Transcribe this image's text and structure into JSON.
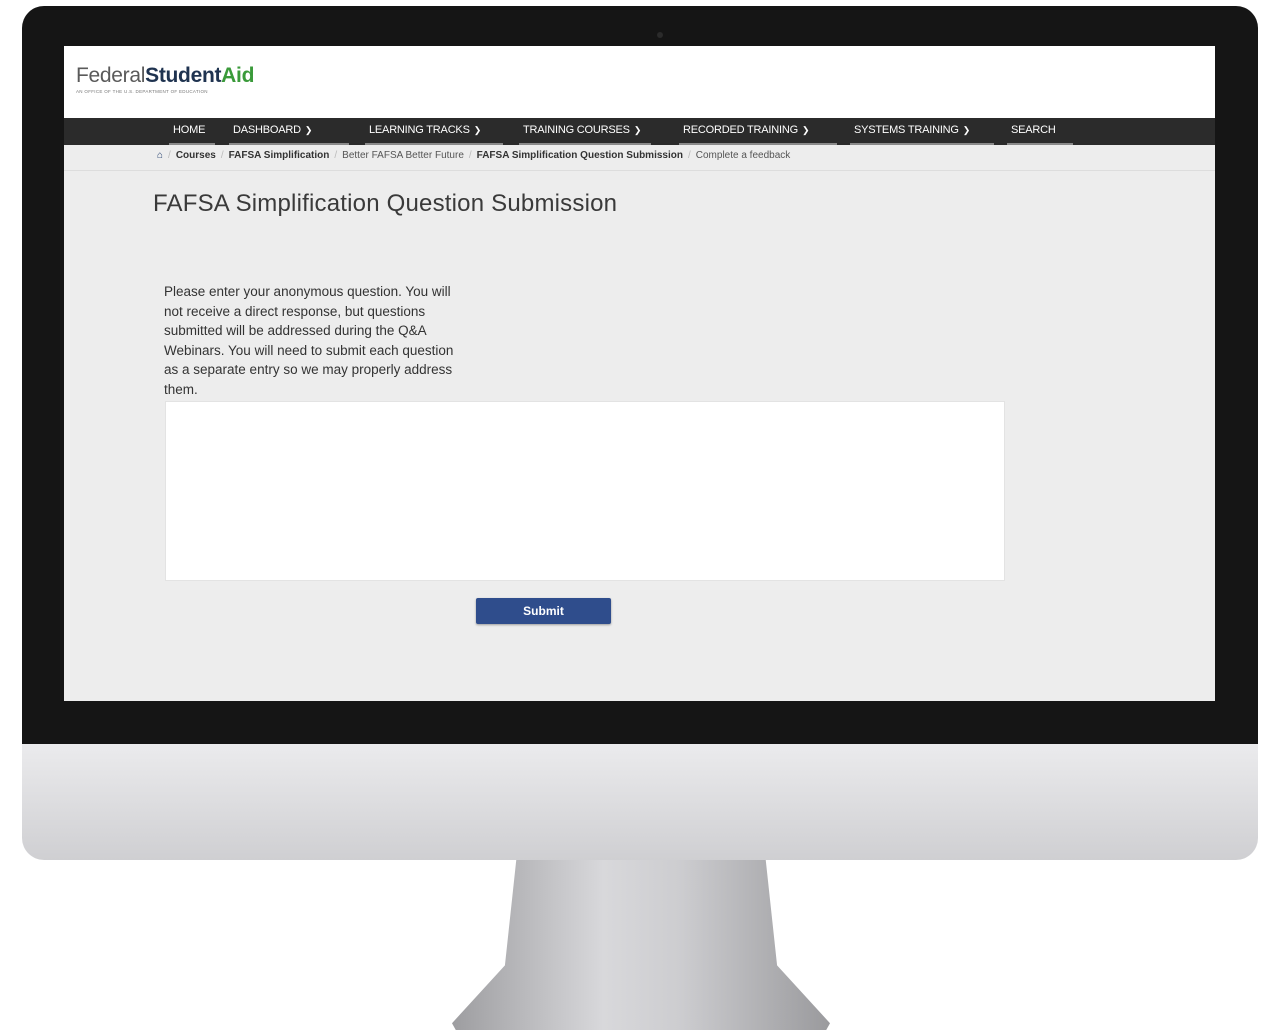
{
  "brand": {
    "word_federal": "Federal",
    "word_student": "Student",
    "word_aid": "Aid",
    "tagline": "An OFFICE of the U.S. DEPARTMENT of EDUCATION",
    "colors": {
      "federal": "#5a5a5a",
      "student": "#1f3350",
      "aid": "#3a9a3a"
    }
  },
  "nav": {
    "items": [
      {
        "label": "HOME",
        "dropdown": false
      },
      {
        "label": "DASHBOARD",
        "dropdown": true
      },
      {
        "label": "LEARNING TRACKS",
        "dropdown": true
      },
      {
        "label": "TRAINING COURSES",
        "dropdown": true
      },
      {
        "label": "RECORDED TRAINING",
        "dropdown": true
      },
      {
        "label": "SYSTEMS TRAINING",
        "dropdown": true
      },
      {
        "label": "SEARCH",
        "dropdown": false
      }
    ],
    "dropdown_icon": "chevron-down-icon"
  },
  "breadcrumb": {
    "home_icon": "home-icon",
    "items": [
      {
        "label": "Courses"
      },
      {
        "label": "FAFSA Simplification"
      },
      {
        "label": "Better FAFSA Better Future"
      },
      {
        "label": "FAFSA Simplification Question Submission"
      },
      {
        "label": "Complete a feedback"
      }
    ]
  },
  "page": {
    "title": "FAFSA Simplification Question Submission",
    "prompt": "Please enter your anonymous question. You will not receive a direct response, but questions submitted will be addressed during the Q&A Webinars. You will need to submit each question as a separate entry so we may properly address them.",
    "answer_value": "",
    "submit_label": "Submit"
  },
  "colors": {
    "nav_bg": "#2b2b2b",
    "page_bg": "#ededed",
    "submit_bg": "#2f4d8c"
  }
}
